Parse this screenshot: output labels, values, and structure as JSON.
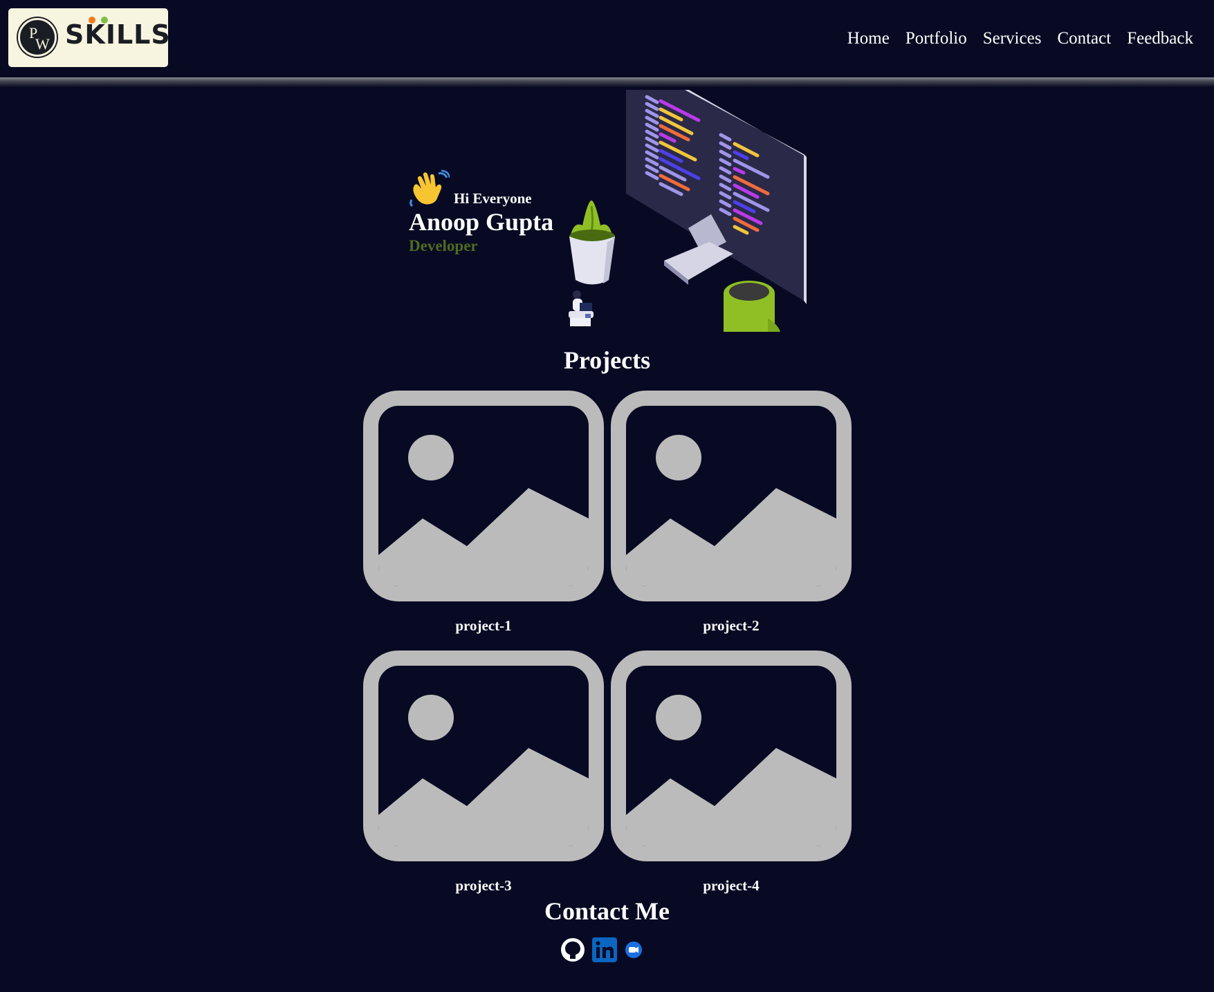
{
  "header": {
    "logo": {
      "text": "SKILLS",
      "seal_letters": [
        "P",
        "W"
      ]
    },
    "nav": [
      "Home",
      "Portfolio",
      "Services",
      "Contact",
      "Feedback"
    ]
  },
  "hero": {
    "greeting": "Hi Everyone",
    "name": "Anoop Gupta",
    "role": "Developer",
    "role_color": "#4e6b1f"
  },
  "projects": {
    "title": "Projects",
    "items": [
      {
        "label": "project-1",
        "icon": "image-placeholder-icon"
      },
      {
        "label": "project-2",
        "icon": "image-placeholder-icon"
      },
      {
        "label": "project-3",
        "icon": "image-placeholder-icon"
      },
      {
        "label": "project-4",
        "icon": "image-placeholder-icon"
      }
    ]
  },
  "contact": {
    "title": "Contact Me",
    "icons": [
      "github-icon",
      "linkedin-icon",
      "video-call-icon"
    ]
  },
  "colors": {
    "background": "#080a23",
    "placeholder": "#bbbbbb",
    "logo_bg": "#f7f4df"
  }
}
